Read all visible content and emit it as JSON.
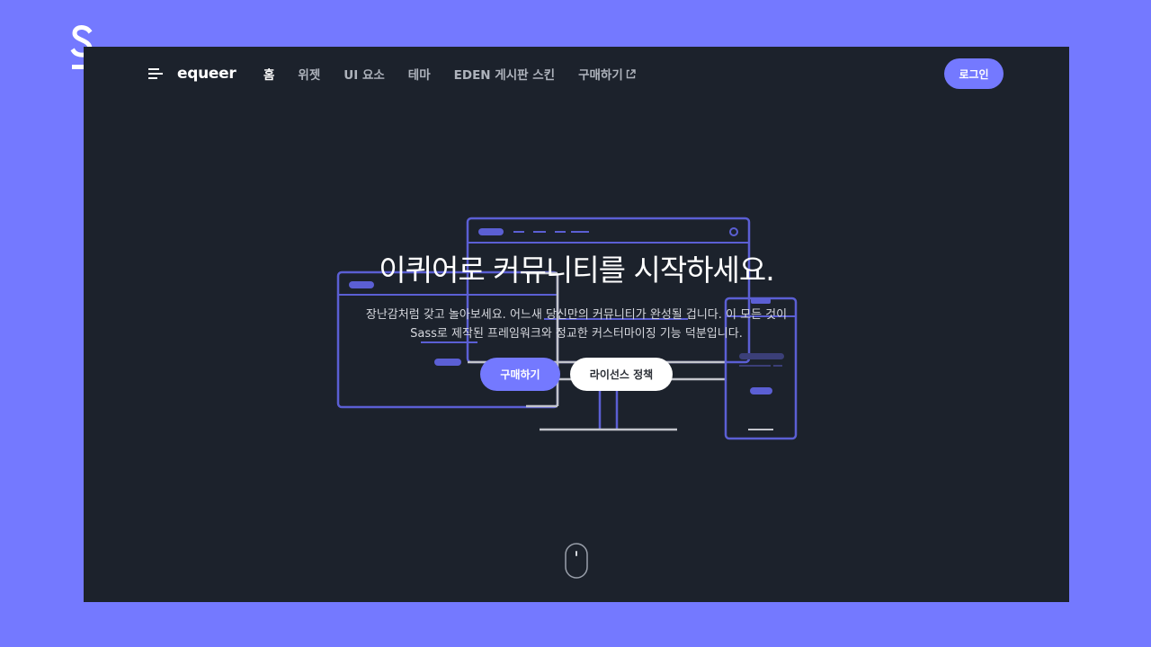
{
  "brand": {
    "mark_icon": "s-letter-logo-icon",
    "logo_text": "equeer"
  },
  "nav": {
    "menu_icon": "hamburger-menu-icon",
    "links": [
      {
        "label": "홈",
        "active": true
      },
      {
        "label": "위젯",
        "active": false
      },
      {
        "label": "UI 요소",
        "active": false
      },
      {
        "label": "테마",
        "active": false
      },
      {
        "label": "EDEN 게시판 스킨",
        "active": false
      },
      {
        "label": "구매하기",
        "active": false,
        "icon": "external-link-icon"
      }
    ],
    "login_label": "로그인"
  },
  "hero": {
    "title": "이퀴어로 커뮤니티를 시작하세요.",
    "desc_line1": "장난감처럼 갖고 놀아보세요. 어느새 당신만의 커뮤니티가 완성될 겁니다. 이 모든 것이",
    "desc_line2": "Sass로 제작된 프레임워크와 정교한 커스터마이징 기능 덕분입니다.",
    "buy_label": "구매하기",
    "license_label": "라이선스 정책",
    "illustration_icon": "responsive-devices-illustration"
  },
  "scroll_icon": "mouse-scroll-icon",
  "colors": {
    "page_bg": "#7479ff",
    "screen_bg": "#1c222c",
    "accent": "#7479ff",
    "device_stroke": "#5b5fd4",
    "device_stroke_light": "#c3c5cc",
    "nav_text": "#aeb3bc"
  }
}
